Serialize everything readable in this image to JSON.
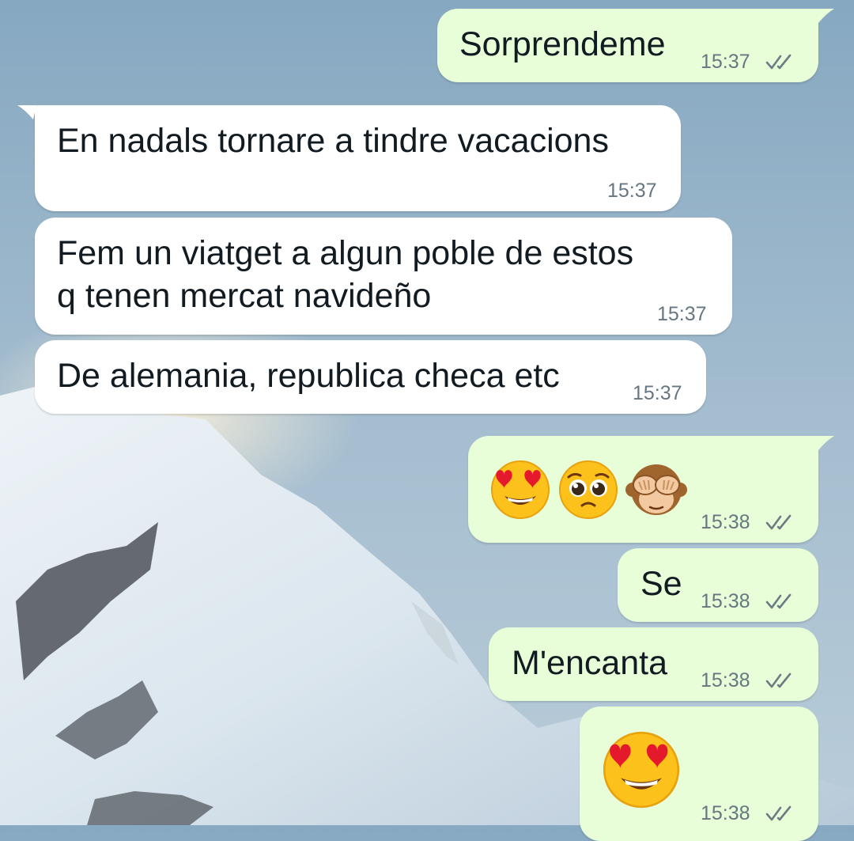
{
  "chat": {
    "colors": {
      "outgoing_bubble": "#e7fed8",
      "incoming_bubble": "#ffffff",
      "timestamp": "#667781",
      "read_ticks": "#6b7c85"
    },
    "wallpaper": "snowy-mountain-photo",
    "messages": [
      {
        "direction": "outgoing",
        "text": "Sorprendeme",
        "time": "15:37",
        "status_icon": "double-check-icon"
      },
      {
        "direction": "incoming",
        "text": "En nadals tornare a tindre vacacions",
        "time": "15:37"
      },
      {
        "direction": "incoming",
        "text": "Fem un viatget a algun poble de estos\nq tenen mercat navideño",
        "time": "15:37"
      },
      {
        "direction": "incoming",
        "text": "De alemania, republica checa etc",
        "time": "15:37"
      },
      {
        "direction": "outgoing",
        "emojis": [
          "heart-eyes-emoji",
          "pleading-face-emoji",
          "see-no-evil-monkey-emoji"
        ],
        "time": "15:38",
        "status_icon": "double-check-icon"
      },
      {
        "direction": "outgoing",
        "text": "Se",
        "time": "15:38",
        "status_icon": "double-check-icon"
      },
      {
        "direction": "outgoing",
        "text": "M'encanta",
        "time": "15:38",
        "status_icon": "double-check-icon"
      },
      {
        "direction": "outgoing",
        "emojis": [
          "heart-eyes-emoji"
        ],
        "time": "15:38",
        "status_icon": "double-check-icon"
      }
    ]
  }
}
